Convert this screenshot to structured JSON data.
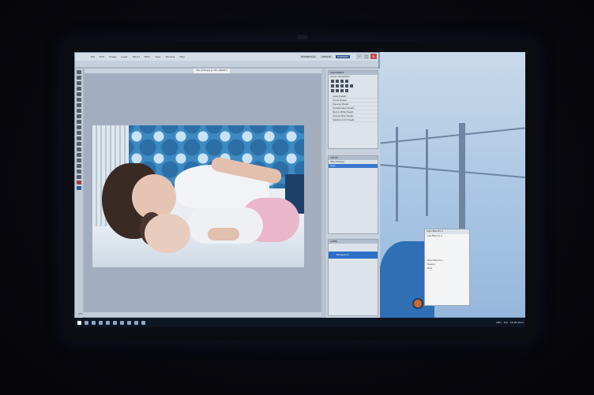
{
  "photoshop": {
    "menu": [
      "File",
      "Edit",
      "Image",
      "Layer",
      "Select",
      "Filter",
      "View",
      "Window",
      "Help"
    ],
    "workspaces": [
      "ESSENTIALS",
      "DESIGN",
      "PAINTING"
    ],
    "window_controls": [
      "–",
      "□",
      "x"
    ],
    "document_tab": "IMG_0218.jpg @ 25% (RGB/8*)",
    "status_text": "25%",
    "adjustments_panel": {
      "tab": "ADJUSTMENTS",
      "title": "Add an adjustment",
      "presets": [
        "Levels Presets",
        "Curves Presets",
        "Exposure Presets",
        "Hue/Saturation Presets",
        "Black & White Presets",
        "Channel Mixer Presets",
        "Selective Color Presets"
      ]
    },
    "history_panel": {
      "tab": "HISTORY",
      "items": [
        "IMG_0218.jpg",
        "Open"
      ]
    },
    "layers_panel": {
      "tab": "LAYERS",
      "layer": "Background"
    }
  },
  "plugin_window": {
    "title": "Color Efex Pro 4",
    "lines": [
      "Last Filter Pro 4",
      "Silver Efex Pro 2",
      "Viveza 2",
      "Tools"
    ]
  },
  "taskbar": {
    "time": "Tue",
    "date": "09.05.2017",
    "lang": "DEU"
  }
}
